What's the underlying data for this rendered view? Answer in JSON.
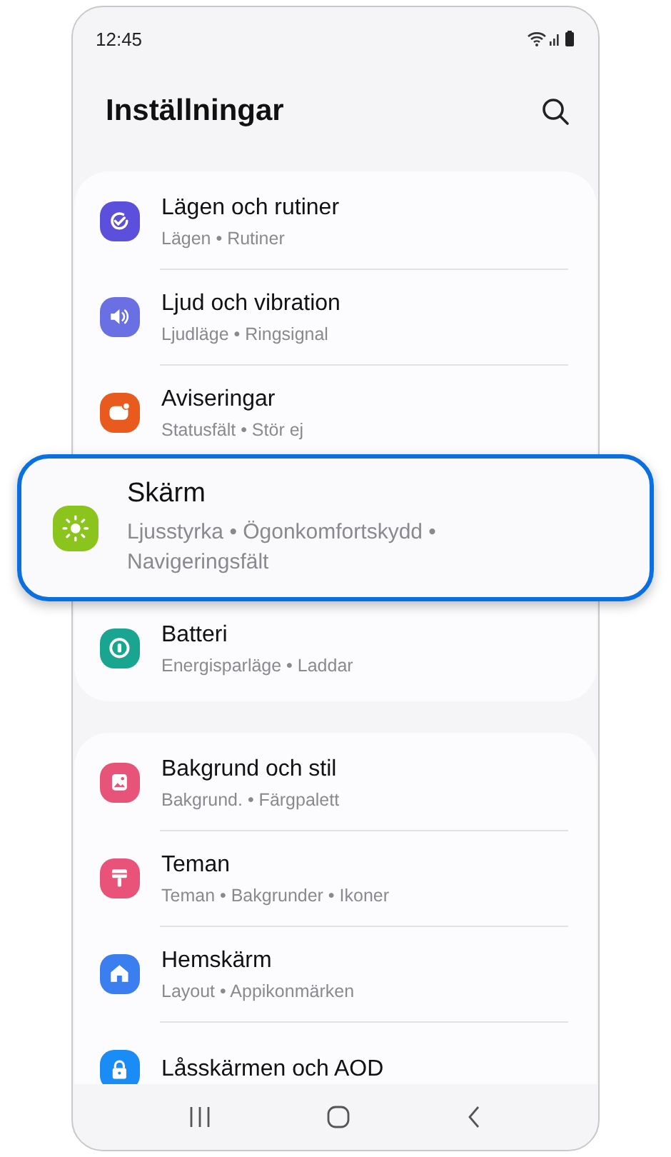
{
  "status_bar": {
    "time": "12:45"
  },
  "header": {
    "title": "Inställningar"
  },
  "groups": [
    {
      "items": [
        {
          "title": "Lägen och rutiner",
          "subtitle": "Lägen • Rutiner",
          "kind": "routines",
          "color": "#5b4fdc",
          "highlighted": false
        },
        {
          "title": "Ljud och vibration",
          "subtitle": "Ljudläge • Ringsignal",
          "kind": "sound",
          "color": "#6a70e4",
          "highlighted": false
        },
        {
          "title": "Aviseringar",
          "subtitle": "Statusfält • Stör ej",
          "kind": "notifications",
          "color": "#e95a1f",
          "highlighted": false
        },
        {
          "title": "Skärm",
          "subtitle": "Ljusstyrka • Ögonkomfortskydd • Navigeringsfält",
          "kind": "display",
          "color": "#8bc41d",
          "highlighted": true
        },
        {
          "title": "Batteri",
          "subtitle": "Energisparläge • Laddar",
          "kind": "battery",
          "color": "#1aa591",
          "highlighted": false
        }
      ]
    },
    {
      "items": [
        {
          "title": "Bakgrund och stil",
          "subtitle": "Bakgrund. • Färgpalett",
          "kind": "wallpaper",
          "color": "#e8537a",
          "highlighted": false
        },
        {
          "title": "Teman",
          "subtitle": "Teman • Bakgrunder • Ikoner",
          "kind": "themes",
          "color": "#e9537a",
          "highlighted": false
        },
        {
          "title": "Hemskärm",
          "subtitle": "Layout • Appikonmärken",
          "kind": "home",
          "color": "#3a7ef0",
          "highlighted": false
        },
        {
          "title": "Låsskärmen och AOD",
          "kind": "lock",
          "color": "#1a8cf5",
          "highlighted": false
        }
      ]
    }
  ]
}
